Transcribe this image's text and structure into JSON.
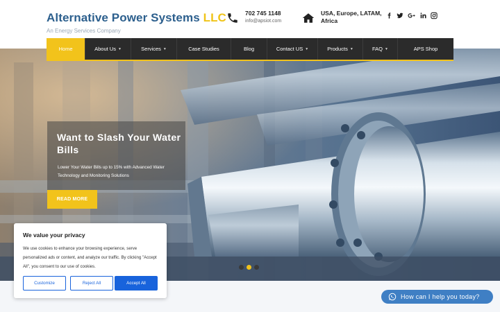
{
  "brand": {
    "title_main": "Alternative Power Systems",
    "title_suffix": "LLC",
    "tagline": "An Energy Services Company"
  },
  "contact": {
    "phone": "702 745 1148",
    "email": "info@apsiot.com",
    "phone_icon": "phone-icon",
    "region": "USA, Europe, LATAM, Africa",
    "region_icon": "home-icon"
  },
  "social": {
    "facebook": "f",
    "twitter": "t",
    "google": "g+",
    "linkedin": "in",
    "instagram": "ig"
  },
  "nav": {
    "items": [
      {
        "label": "Home",
        "active": true,
        "dropdown": false
      },
      {
        "label": "About Us",
        "active": false,
        "dropdown": true
      },
      {
        "label": "Services",
        "active": false,
        "dropdown": true
      },
      {
        "label": "Case Studies",
        "active": false,
        "dropdown": false
      },
      {
        "label": "Blog",
        "active": false,
        "dropdown": false
      },
      {
        "label": "Contact US",
        "active": false,
        "dropdown": true
      },
      {
        "label": "Products",
        "active": false,
        "dropdown": true
      },
      {
        "label": "FAQ",
        "active": false,
        "dropdown": true
      },
      {
        "label": "APS Shop",
        "active": false,
        "dropdown": false
      }
    ],
    "caret": "▼"
  },
  "hero": {
    "title": "Want to Slash Your Water Bills",
    "subtitle": "Lower Your Water Bills up to 15% with Advanced Water Technology and Monitoring Solutions",
    "button": "READ MORE",
    "slides_total": 3,
    "slide_active": 2
  },
  "cookie": {
    "title": "We value your privacy",
    "text": "We use cookies to enhance your browsing experience, serve personalized ads or content, and analyze our traffic. By clicking \"Accept All\", you consent to our use of cookies.",
    "customize": "Customize",
    "reject": "Reject All",
    "accept": "Accept All"
  },
  "chat": {
    "label": "How can I help you today?",
    "icon": "whatsapp-icon"
  },
  "colors": {
    "accent": "#f2c31b",
    "brand_blue": "#2c5f8d",
    "nav_bg": "#2b2b2b",
    "cookie_blue": "#1863dc",
    "chat_blue": "#3f7fc4"
  }
}
